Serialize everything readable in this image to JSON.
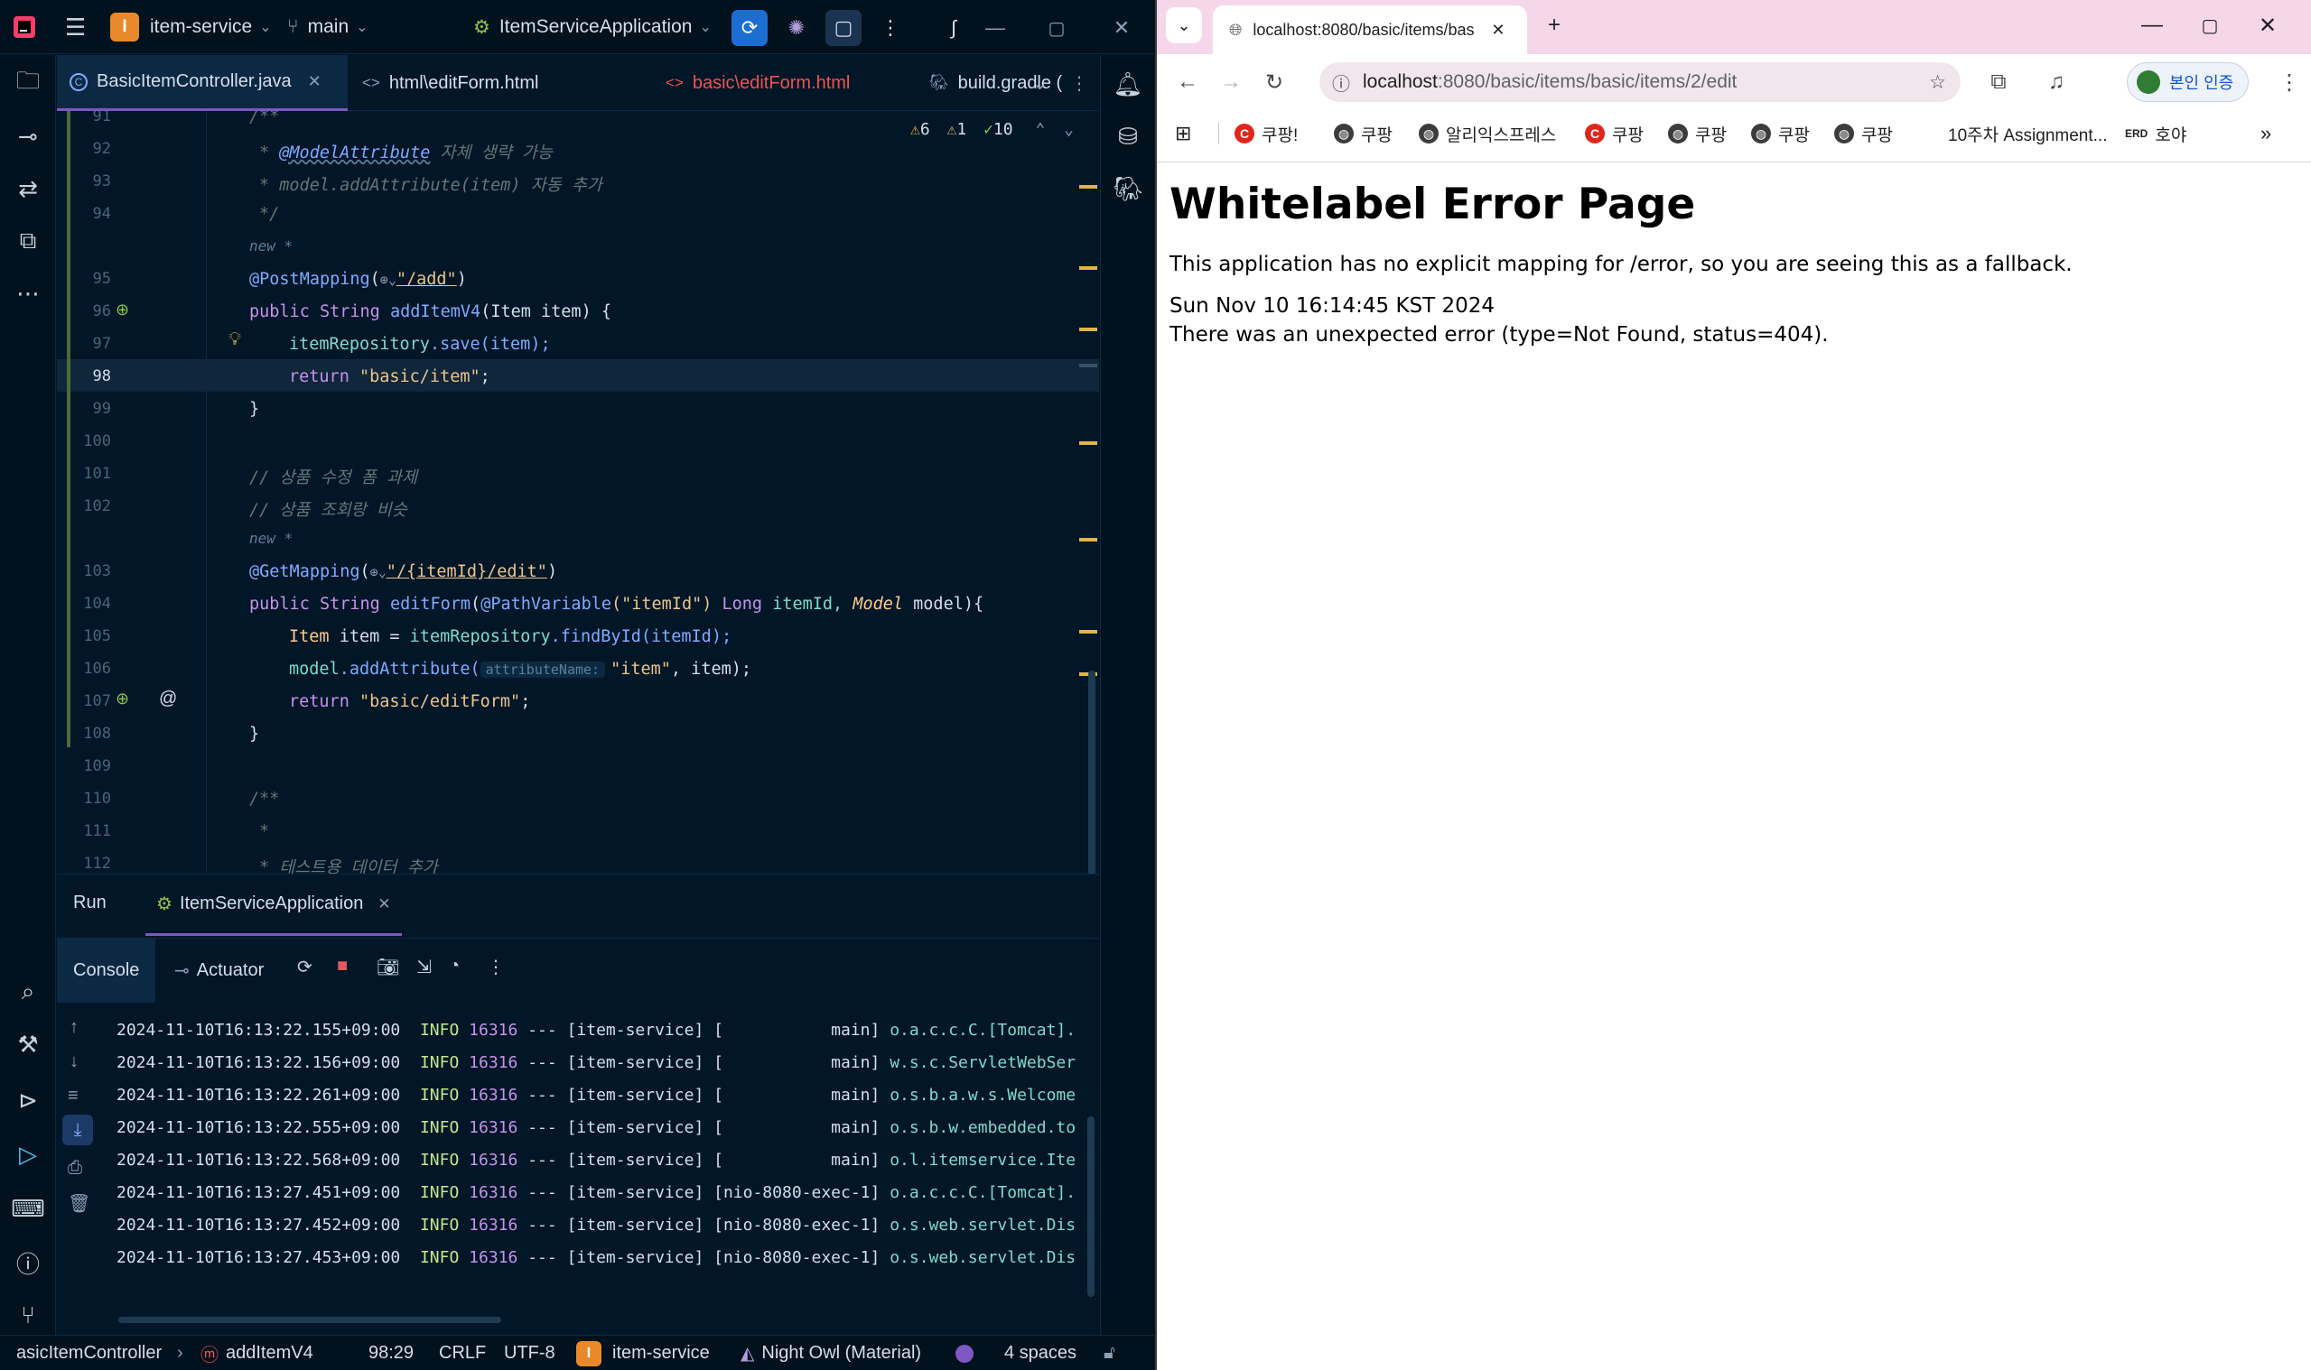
{
  "ide": {
    "project_badge": "I",
    "project_name": "item-service",
    "branch": "main",
    "run_config": "ItemServiceApplication",
    "editor_tabs": [
      {
        "label": "BasicItemController.java",
        "icon": "C",
        "color": "#d6deeb"
      },
      {
        "label": "html\\editForm.html",
        "icon": "<>",
        "color": "#d6deeb"
      },
      {
        "label": "basic\\editForm.html",
        "icon": "<>",
        "color": "#ef5350"
      },
      {
        "label": "build.gradle (",
        "icon": "gradle",
        "color": "#d6deeb"
      }
    ],
    "inspections": {
      "warnings": "6",
      "weak_warnings": "1",
      "ok": "10"
    },
    "code": {
      "line_numbers": [
        "91",
        "92",
        "93",
        "94",
        "95",
        "96",
        "97",
        "98",
        "99",
        "100",
        "101",
        "102",
        "103",
        "104",
        "105",
        "106",
        "107",
        "108",
        "109",
        "110",
        "111",
        "112"
      ],
      "current_line": "98",
      "hint_new": "new *",
      "l91": "/**",
      "l92_ann": "@ModelAttribute",
      "l92_rest": " 자체 생략 가능",
      "l93": "* model.addAttribute(item) 자동 추가",
      "l94": "*/",
      "l95_ann": "@PostMapping",
      "l95_path": "\"/add\"",
      "l96_a": "public ",
      "l96_b": "String ",
      "l96_c": "addItemV4",
      "l96_d": "(Item item) {",
      "l97_a": "itemRepository",
      "l97_b": ".save(item);",
      "l98_a": "return ",
      "l98_b": "\"basic/item\"",
      "l98_c": ";",
      "l99": "}",
      "l101": "// 상품 수정 폼 과제",
      "l102": "// 상품 조회랑 비슷",
      "l103_ann": "@GetMapping",
      "l103_path": "\"/{itemId}/edit\"",
      "l104_a": "public ",
      "l104_b": "String ",
      "l104_c": "editForm",
      "l104_d": "(",
      "l104_e": "@PathVariable",
      "l104_f": "(\"itemId\") ",
      "l104_g": "Long ",
      "l104_h": "itemId, ",
      "l104_i": "Model ",
      "l104_j": "model){",
      "l105_a": "Item ",
      "l105_b": "item = ",
      "l105_c": "itemRepository",
      "l105_d": ".findById(itemId);",
      "l106_a": "model",
      "l106_b": ".addAttribute(",
      "l106_hint": "attributeName:",
      "l106_c": "\"item\"",
      "l106_d": ", item);",
      "l107_a": "return ",
      "l107_b": "\"basic/editForm\"",
      "l107_c": ";",
      "l108": "}",
      "l110": "/**",
      "l111": "*",
      "l112": "* 테스트용 데이터 추가"
    },
    "run": {
      "panel_title": "Run",
      "app_tab": "ItemServiceApplication",
      "console_tab": "Console",
      "actuator_tab": "Actuator",
      "logs": [
        {
          "ts": "2024-11-10T16:13:22.155+09:00",
          "level": "INFO",
          "pid": "16316",
          "sep": "---",
          "app": "[item-service]",
          "thread": "[           main]",
          "logger": "o.a.c.c.C.[Tomcat]."
        },
        {
          "ts": "2024-11-10T16:13:22.156+09:00",
          "level": "INFO",
          "pid": "16316",
          "sep": "---",
          "app": "[item-service]",
          "thread": "[           main]",
          "logger": "w.s.c.ServletWebSer"
        },
        {
          "ts": "2024-11-10T16:13:22.261+09:00",
          "level": "INFO",
          "pid": "16316",
          "sep": "---",
          "app": "[item-service]",
          "thread": "[           main]",
          "logger": "o.s.b.a.w.s.Welcome"
        },
        {
          "ts": "2024-11-10T16:13:22.555+09:00",
          "level": "INFO",
          "pid": "16316",
          "sep": "---",
          "app": "[item-service]",
          "thread": "[           main]",
          "logger": "o.s.b.w.embedded.to"
        },
        {
          "ts": "2024-11-10T16:13:22.568+09:00",
          "level": "INFO",
          "pid": "16316",
          "sep": "---",
          "app": "[item-service]",
          "thread": "[           main]",
          "logger": "o.l.itemservice.Ite"
        },
        {
          "ts": "2024-11-10T16:13:27.451+09:00",
          "level": "INFO",
          "pid": "16316",
          "sep": "---",
          "app": "[item-service]",
          "thread": "[nio-8080-exec-1]",
          "logger": "o.a.c.c.C.[Tomcat]."
        },
        {
          "ts": "2024-11-10T16:13:27.452+09:00",
          "level": "INFO",
          "pid": "16316",
          "sep": "---",
          "app": "[item-service]",
          "thread": "[nio-8080-exec-1]",
          "logger": "o.s.web.servlet.Dis"
        },
        {
          "ts": "2024-11-10T16:13:27.453+09:00",
          "level": "INFO",
          "pid": "16316",
          "sep": "---",
          "app": "[item-service]",
          "thread": "[nio-8080-exec-1]",
          "logger": "o.s.web.servlet.Dis"
        }
      ]
    },
    "status": {
      "breadcrumb_class": "asicItemController",
      "breadcrumb_method": "addItemV4",
      "position": "98:29",
      "line_sep": "CRLF",
      "encoding": "UTF-8",
      "project_badge": "I",
      "project": "item-service",
      "theme": "Night Owl (Material)",
      "indent": "4 spaces"
    }
  },
  "browser": {
    "tab_title": "localhost:8080/basic/items/bas",
    "url_host": "localhost",
    "url_rest": ":8080/basic/items/basic/items/2/edit",
    "profile_label": "본인 인증",
    "bookmarks": [
      {
        "label": "쿠팡!",
        "icon": "C"
      },
      {
        "label": "쿠팡",
        "icon": "globe"
      },
      {
        "label": "알리익스프레스",
        "icon": "globe"
      },
      {
        "label": "쿠팡",
        "icon": "C"
      },
      {
        "label": "쿠팡",
        "icon": "globe"
      },
      {
        "label": "쿠팡",
        "icon": "globe"
      },
      {
        "label": "쿠팡",
        "icon": "globe"
      },
      {
        "label": "10주차 Assignment...",
        "icon": "none"
      },
      {
        "label": "호야",
        "icon": "ERD"
      }
    ],
    "page": {
      "heading": "Whitelabel Error Page",
      "message": "This application has no explicit mapping for /error, so you are seeing this as a fallback.",
      "timestamp": "Sun Nov 10 16:14:45 KST 2024",
      "error": "There was an unexpected error (type=Not Found, status=404)."
    }
  },
  "colors": {
    "ide_bg": "#011627",
    "accent": "#7e57c2",
    "browser_tabstrip": "#f6d7e9"
  }
}
